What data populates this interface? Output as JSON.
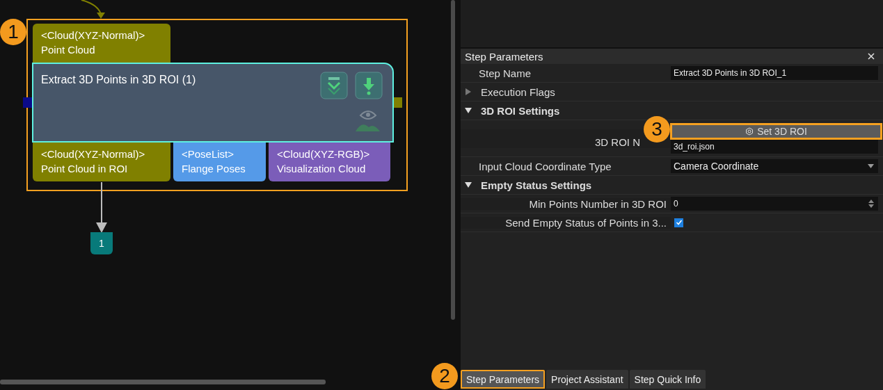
{
  "canvas": {
    "node": {
      "title": "Extract 3D Points in 3D ROI (1)",
      "selected": true,
      "highlighted": true,
      "inputs": [
        {
          "type": "<Cloud(XYZ-Normal)>",
          "name": "Point Cloud",
          "color": "#808000"
        }
      ],
      "outputs": [
        {
          "type": "<Cloud(XYZ-Normal)>",
          "name": "Point Cloud in ROI",
          "color": "#808000"
        },
        {
          "type": "<PoseList>",
          "name": "Flange Poses",
          "color": "#559ae8"
        },
        {
          "type": "<Cloud(XYZ-RGB)>",
          "name": "Visualization Cloud",
          "color": "#7b5db9"
        }
      ]
    },
    "output_marker": "1"
  },
  "callouts": [
    "1",
    "2",
    "3"
  ],
  "panel": {
    "title": "Step Parameters",
    "rows": [
      {
        "kind": "text",
        "label": "Step Name",
        "value": "Extract 3D Points in 3D ROI_1"
      },
      {
        "kind": "group",
        "label": "Execution Flags",
        "expanded": false
      },
      {
        "kind": "group",
        "label": "3D ROI Settings",
        "expanded": true,
        "children": [
          {
            "kind": "roi",
            "label": "3D ROI N",
            "button": "Set 3D ROI",
            "highlighted": true,
            "value": "3d_roi.json"
          }
        ]
      },
      {
        "kind": "dropdown",
        "label": "Input Cloud Coordinate Type",
        "value": "Camera Coordinate"
      },
      {
        "kind": "group",
        "label": "Empty Status Settings",
        "expanded": true,
        "children": [
          {
            "kind": "spin",
            "label": "Min Points Number in 3D ROI",
            "value": "0"
          },
          {
            "kind": "checkbox",
            "label": "Send Empty Status of Points in 3...",
            "checked": true
          }
        ]
      }
    ]
  },
  "tabs": [
    {
      "label": "Step Parameters",
      "selected": true,
      "highlighted": true
    },
    {
      "label": "Project Assistant",
      "selected": false,
      "highlighted": false
    },
    {
      "label": "Step Quick Info",
      "selected": false,
      "highlighted": false
    }
  ]
}
